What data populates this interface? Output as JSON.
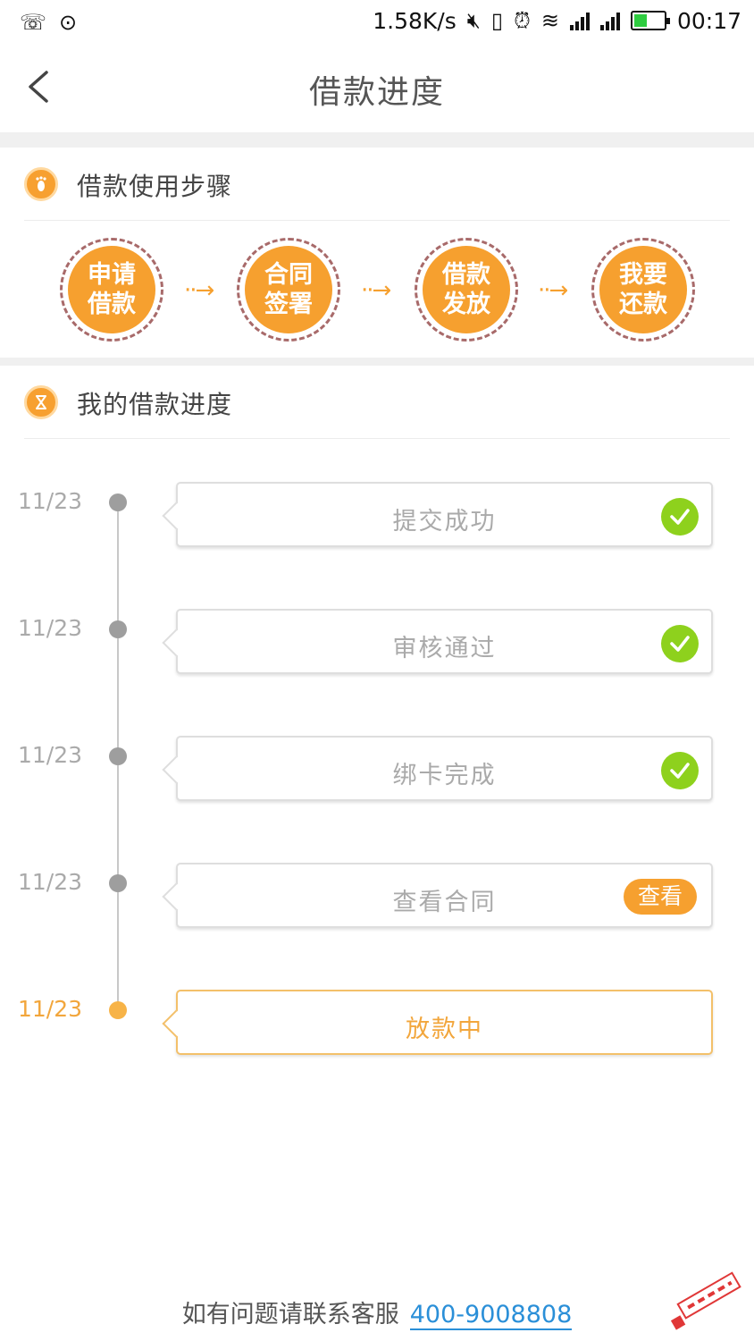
{
  "status_bar": {
    "network_speed": "1.58K/s",
    "time": "00:17",
    "icons": [
      "missed-call-icon",
      "message-icon",
      "mute-icon",
      "vibrate-off-icon",
      "alarm-icon",
      "wifi-icon",
      "signal-icon",
      "signal-icon",
      "battery-icon"
    ]
  },
  "header": {
    "title": "借款进度",
    "back_icon": "chevron-left-icon"
  },
  "steps_section": {
    "title": "借款使用步骤",
    "icon": "footprint-icon",
    "steps": [
      {
        "line1": "申请",
        "line2": "借款"
      },
      {
        "line1": "合同",
        "line2": "签署"
      },
      {
        "line1": "借款",
        "line2": "发放"
      },
      {
        "line1": "我要",
        "line2": "还款"
      }
    ],
    "arrow_glyph": "··→"
  },
  "progress_section": {
    "title": "我的借款进度",
    "icon": "hourglass-icon",
    "items": [
      {
        "date": "11/23",
        "label": "提交成功",
        "status": "done"
      },
      {
        "date": "11/23",
        "label": "审核通过",
        "status": "done"
      },
      {
        "date": "11/23",
        "label": "绑卡完成",
        "status": "done"
      },
      {
        "date": "11/23",
        "label": "查看合同",
        "status": "action",
        "action_label": "查看"
      },
      {
        "date": "11/23",
        "label": "放款中",
        "status": "active"
      }
    ]
  },
  "footer": {
    "text": "如有问题请联系客服",
    "phone": "400-9008808"
  },
  "colors": {
    "accent_orange": "#f6a02f",
    "check_green": "#8ed11d",
    "link_blue": "#2a8fd8"
  }
}
